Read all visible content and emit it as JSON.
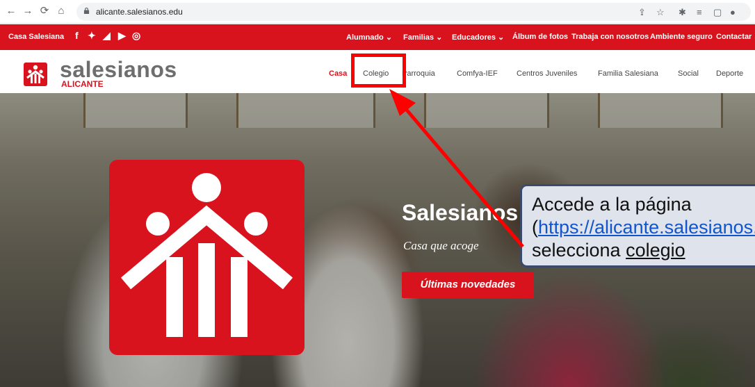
{
  "browser": {
    "url": "alicante.salesianos.edu",
    "icons": [
      "back-icon",
      "forward-icon",
      "reload-icon",
      "home-icon",
      "lock-icon",
      "share-icon",
      "star-icon",
      "extensions-icon",
      "reading-list-icon",
      "sidepanel-icon",
      "profile-icon"
    ]
  },
  "topbar": {
    "brand": "Casa Salesiana",
    "social": [
      "facebook-icon",
      "twitter-icon",
      "rss-icon",
      "youtube-icon",
      "instagram-icon"
    ],
    "links": [
      "Alumnado ⌄",
      "Familias ⌄",
      "Educadores ⌄",
      "Álbum de fotos",
      "Trabaja con nosotros",
      "Ambiente seguro",
      "Contactar"
    ]
  },
  "header": {
    "logo_word": "salesianos",
    "logo_sub": "ALICANTE",
    "menu": [
      "Casa",
      "Colegio",
      "Parroquia",
      "Comfya-IEF",
      "Centros Juveniles",
      "Familia Salesiana",
      "Social",
      "Deporte"
    ],
    "active": "Casa"
  },
  "hero": {
    "title": "Salesianos",
    "subtitle": "Casa que acoge",
    "button": "Últimas novedades"
  },
  "callout": {
    "line1": "Accede a la página",
    "link": "https://alicante.salesianos.edu",
    "line2_prefix": "(",
    "line3_prefix": "selecciona ",
    "line3_target": "colegio"
  },
  "colors": {
    "brand_red": "#d9131e",
    "highlight": "#ff0000",
    "callout_border": "#3b4a6b"
  }
}
